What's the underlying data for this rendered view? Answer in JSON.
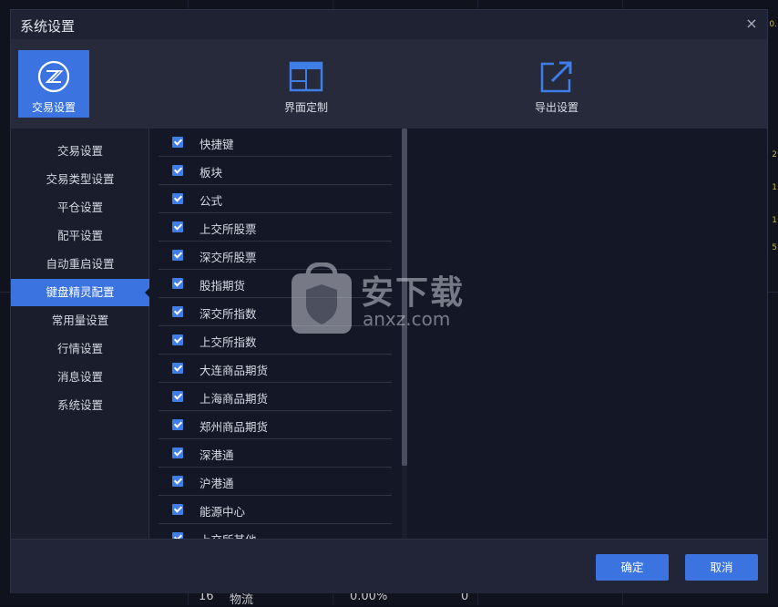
{
  "dialog": {
    "title": "系统设置",
    "close_symbol": "×"
  },
  "toolbar": {
    "items": [
      {
        "label": "交易设置",
        "icon": "trade-settings-icon",
        "active": true
      },
      {
        "label": "界面定制",
        "icon": "layout-custom-icon",
        "active": false
      },
      {
        "label": "导出设置",
        "icon": "export-icon",
        "active": false
      }
    ]
  },
  "sidebar": {
    "items": [
      {
        "label": "交易设置"
      },
      {
        "label": "交易类型设置"
      },
      {
        "label": "平仓设置"
      },
      {
        "label": "配平设置"
      },
      {
        "label": "自动重启设置"
      },
      {
        "label": "键盘精灵配置",
        "active": true
      },
      {
        "label": "常用量设置"
      },
      {
        "label": "行情设置"
      },
      {
        "label": "消息设置"
      },
      {
        "label": "系统设置"
      }
    ]
  },
  "checklist": {
    "items": [
      {
        "label": "快捷键",
        "checked": true
      },
      {
        "label": "板块",
        "checked": true
      },
      {
        "label": "公式",
        "checked": true
      },
      {
        "label": "上交所股票",
        "checked": true
      },
      {
        "label": "深交所股票",
        "checked": true
      },
      {
        "label": "股指期货",
        "checked": true
      },
      {
        "label": "深交所指数",
        "checked": true
      },
      {
        "label": "上交所指数",
        "checked": true
      },
      {
        "label": "大连商品期货",
        "checked": true
      },
      {
        "label": "上海商品期货",
        "checked": true
      },
      {
        "label": "郑州商品期货",
        "checked": true
      },
      {
        "label": "深港通",
        "checked": true
      },
      {
        "label": "沪港通",
        "checked": true
      },
      {
        "label": "能源中心",
        "checked": true
      },
      {
        "label": "上交所其他",
        "checked": true
      }
    ]
  },
  "footer": {
    "ok_label": "确定",
    "cancel_label": "取消"
  },
  "watermark": {
    "text": "安下载",
    "sub": "anxz.com"
  },
  "background": {
    "right_numbers": [
      "0.",
      "2",
      "1",
      "1",
      "5"
    ],
    "bottom_row": {
      "index": "16",
      "name": "物流",
      "pct": "0.00%",
      "value": "0"
    }
  },
  "colors": {
    "accent": "#3b74e0",
    "dialog_bg": "#1f2232",
    "list_bg": "#141726"
  }
}
